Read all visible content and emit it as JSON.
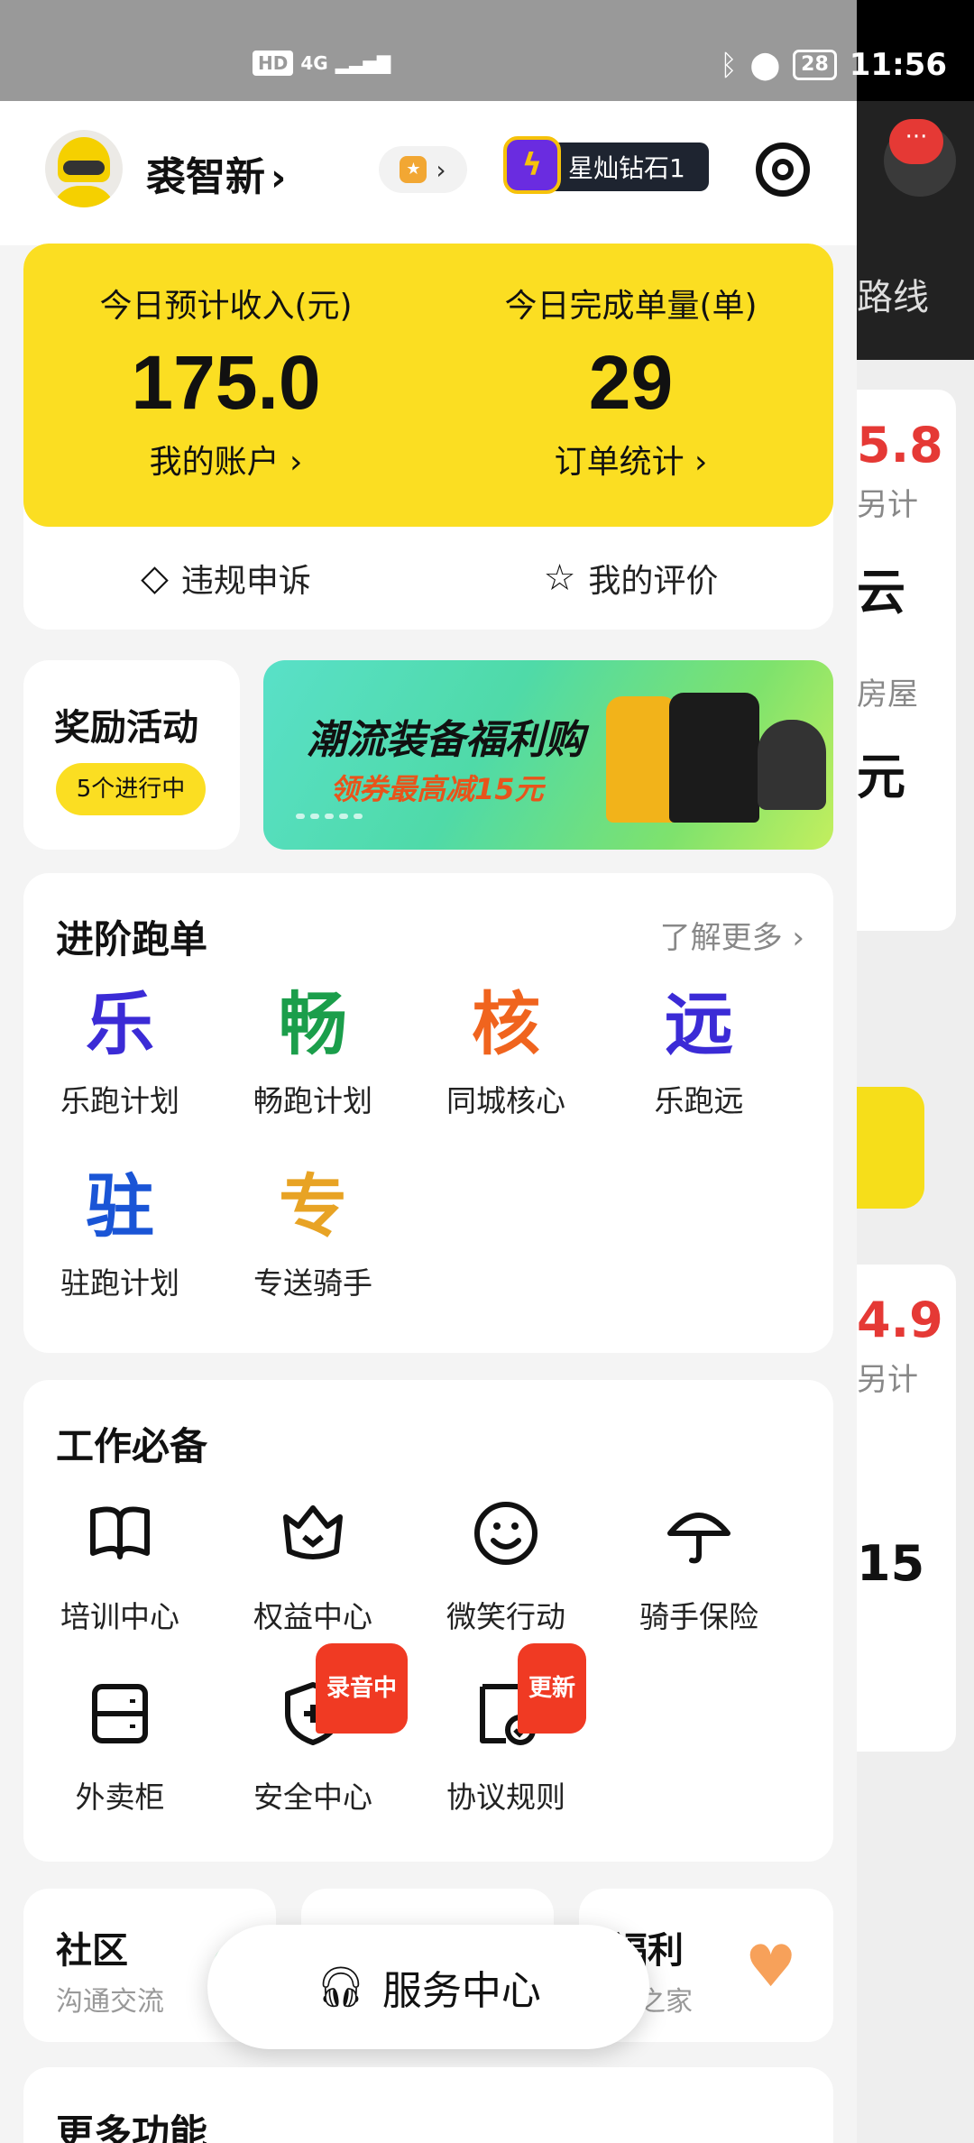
{
  "status_bar": {
    "hd": "HD",
    "network": "4G",
    "battery": "28",
    "time": "11:56"
  },
  "background_page": {
    "route_text": "路线",
    "card1_amount": "5.8",
    "card1_note": "另计",
    "card1_big": "云",
    "card1_label": "房屋",
    "card1_unit": "元",
    "card2_amount": "4.9",
    "card2_note": "另计",
    "card2_big": "15",
    "notif_dots": "···"
  },
  "header": {
    "username": "裘智新",
    "rank_label": "星灿钻石1"
  },
  "earnings": {
    "income_title": "今日预计收入(元)",
    "income_value": "175.0",
    "income_link": "我的账户",
    "orders_title": "今日完成单量(单)",
    "orders_value": "29",
    "orders_link": "订单统计",
    "appeal_label": "违规申诉",
    "rating_label": "我的评价"
  },
  "rewards": {
    "title": "奖励活动",
    "status": "5个进行中"
  },
  "banner": {
    "title": "潮流装备福利购",
    "subtitle": "领券最高减15元"
  },
  "advanced": {
    "title": "进阶跑单",
    "more_label": "了解更多",
    "items": [
      {
        "glyph": "乐",
        "label": "乐跑计划",
        "color": "#3b2bd6"
      },
      {
        "glyph": "畅",
        "label": "畅跑计划",
        "color": "#1b9e4b"
      },
      {
        "glyph": "核",
        "label": "同城核心",
        "color": "#f0641e"
      },
      {
        "glyph": "远",
        "label": "乐跑远",
        "color": "#3b2bd6"
      },
      {
        "glyph": "驻",
        "label": "驻跑计划",
        "color": "#1a55d6"
      },
      {
        "glyph": "专",
        "label": "专送骑手",
        "color": "#e8a324"
      }
    ]
  },
  "tools": {
    "title": "工作必备",
    "items": [
      {
        "label": "培训中心",
        "icon": "book-icon"
      },
      {
        "label": "权益中心",
        "icon": "crown-icon"
      },
      {
        "label": "微笑行动",
        "icon": "smile-icon"
      },
      {
        "label": "骑手保险",
        "icon": "umbrella-icon"
      },
      {
        "label": "外卖柜",
        "icon": "locker-icon"
      },
      {
        "label": "安全中心",
        "icon": "shield-plus-icon",
        "badge": "录音中"
      },
      {
        "label": "协议规则",
        "icon": "doc-check-icon",
        "badge": "更新"
      }
    ]
  },
  "community": {
    "title": "社区",
    "subtitle": "沟通交流"
  },
  "welfare": {
    "title": "福利",
    "subtitle": "手之家"
  },
  "service_center": {
    "label": "服务中心"
  },
  "more_features": {
    "title": "更多功能"
  }
}
